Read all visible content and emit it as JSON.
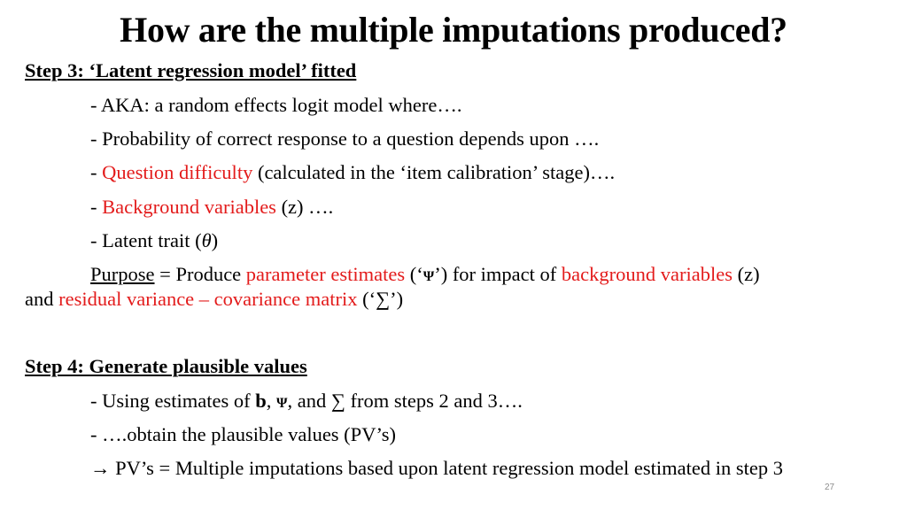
{
  "title": "How are the multiple imputations produced?",
  "step3": {
    "heading": "Step 3: ‘Latent regression model’ fitted",
    "aka": "- AKA: a random effects logit model where….",
    "prob": "- Probability of correct response to a question depends upon ….",
    "qd_dash": "- ",
    "qd_red": "Question difficulty",
    "qd_rest": " (calculated in the ‘item calibration’ stage)….",
    "bv_dash": "- ",
    "bv_red": "Background variables",
    "bv_rest": " (z) ….",
    "lt_text": "- Latent trait (",
    "lt_theta": "θ",
    "lt_close": ")",
    "purpose_label": "Purpose",
    "purpose_eq": " = Produce ",
    "purpose_red1": "parameter estimates",
    "purpose_mid1": " (‘",
    "purpose_psi": "Ψ",
    "purpose_mid2": "’) for impact of ",
    "purpose_red2": "background variables",
    "purpose_end1": " (z)",
    "purpose_and": "and ",
    "purpose_red3": "residual variance – covariance matrix",
    "purpose_end2": " (‘∑’)"
  },
  "step4": {
    "heading": "Step 4: Generate plausible values",
    "using_pre": "- Using estimates of ",
    "using_b": "b",
    "using_comma1": ", ",
    "using_psi": "Ψ",
    "using_rest": ",  and ∑ from steps 2 and 3….",
    "obtain": "- ….obtain the plausible values (PV’s)",
    "conclusion": "→ PV’s = Multiple imputations based upon latent regression model estimated in step 3"
  },
  "page_number": "27"
}
